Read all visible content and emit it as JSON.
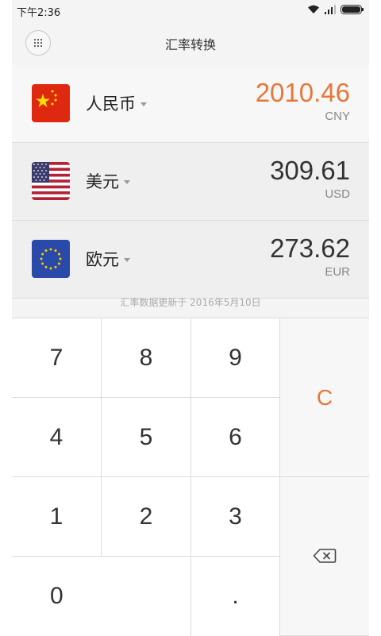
{
  "status": {
    "time": "下午2:36"
  },
  "header": {
    "title": "汇率转换",
    "menu_icon": "grid-icon"
  },
  "currencies": [
    {
      "name": "人民币",
      "amount": "2010.46",
      "code": "CNY",
      "active": true
    },
    {
      "name": "美元",
      "amount": "309.61",
      "code": "USD",
      "active": false
    },
    {
      "name": "欧元",
      "amount": "273.62",
      "code": "EUR",
      "active": false
    }
  ],
  "update_note": "汇率数据更新于 2016年5月10日",
  "keypad": {
    "k7": "7",
    "k8": "8",
    "k9": "9",
    "clear": "C",
    "k4": "4",
    "k5": "5",
    "k6": "6",
    "k1": "1",
    "k2": "2",
    "k3": "3",
    "k0": "0",
    "dot": ".",
    "backspace_icon": "backspace-icon"
  },
  "colors": {
    "accent": "#e6773a",
    "background": "#f4f4f4"
  }
}
